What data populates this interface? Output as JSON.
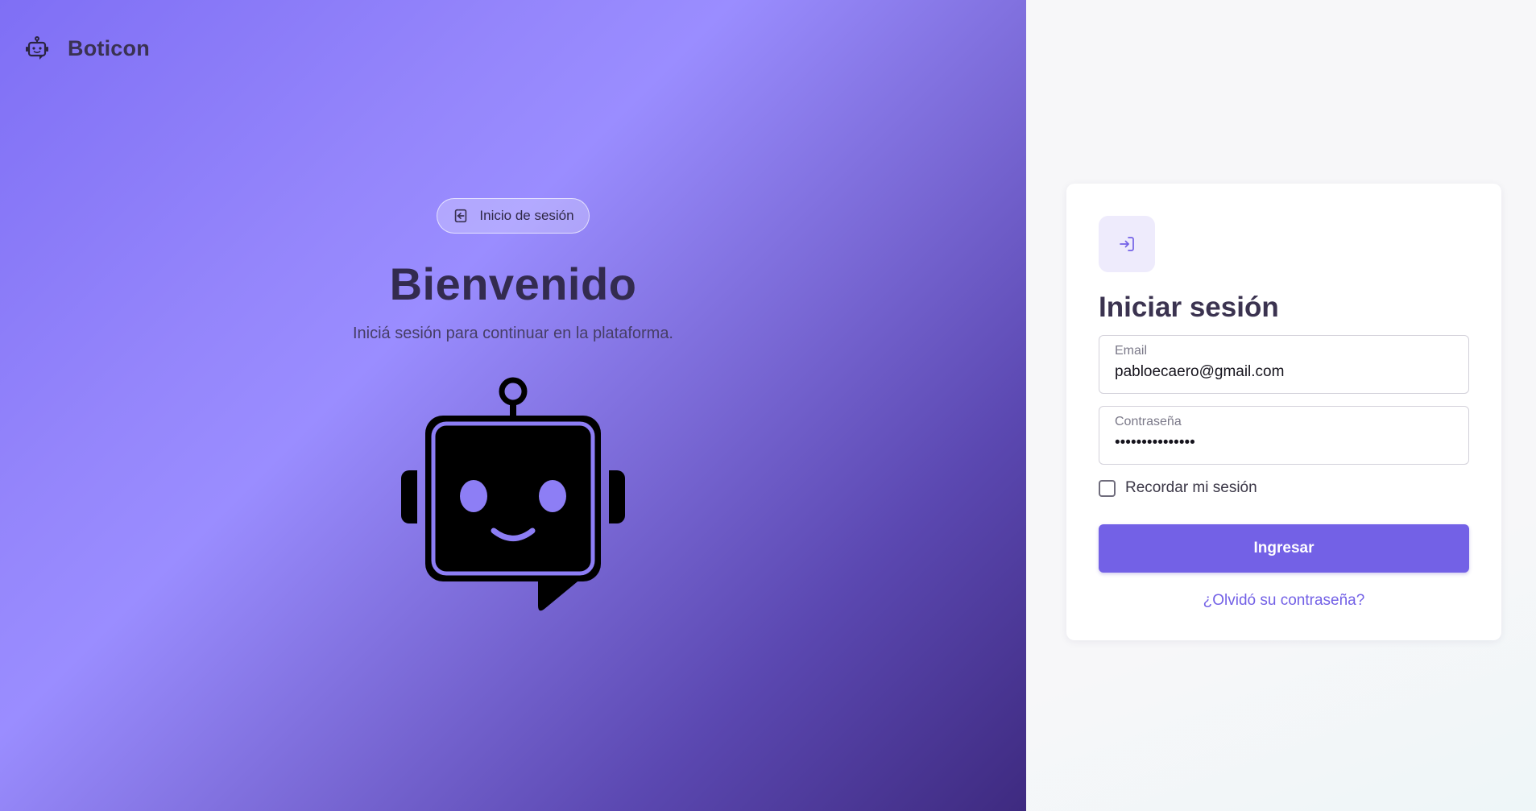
{
  "brand": {
    "name": "Boticon",
    "icon": "robot-icon"
  },
  "hero": {
    "pill_label": "Inicio de sesión",
    "pill_icon": "login-icon",
    "title": "Bienvenido",
    "subtitle": "Iniciá sesión para continuar en la plataforma.",
    "illustration": "robot-chat-icon"
  },
  "login": {
    "header_icon": "sign-in-icon",
    "title": "Iniciar sesión",
    "email": {
      "label": "Email",
      "value": "pabloecaero@gmail.com"
    },
    "password": {
      "label": "Contraseña",
      "value": "•••••••••••••••"
    },
    "remember_label": "Recordar mi sesión",
    "remember_checked": false,
    "submit_label": "Ingresar",
    "forgot_label": "¿Olvidó su contraseña?"
  },
  "colors": {
    "accent": "#7361e6",
    "gradient_start": "#7f6ff5",
    "gradient_end": "#3e2a80"
  }
}
